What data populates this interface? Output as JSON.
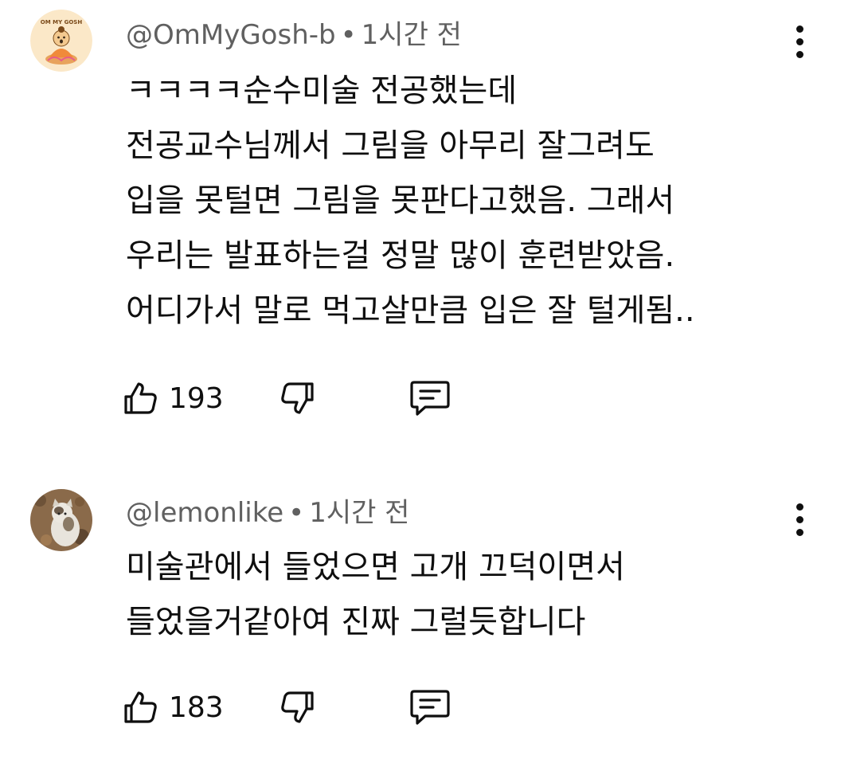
{
  "comments": [
    {
      "author": "@OmMyGosh-b",
      "separator": "•",
      "time": "1시간 전",
      "avatar_text": "OM MY GOSH",
      "text": "ㅋㅋㅋㅋ순수미술 전공했는데\n전공교수님께서 그림을 아무리 잘그려도\n입을 못털면 그림을 못판다고했음. 그래서\n우리는 발표하는걸 정말 많이 훈련받았음.\n어디가서 말로 먹고살만큼 입은 잘 털게됨..",
      "likes": "193"
    },
    {
      "author": "@lemonlike",
      "separator": "•",
      "time": "1시간 전",
      "text": "미술관에서 들었으면 고개 끄덕이면서\n들었을거같아여 진짜 그럴듯합니다",
      "likes": "183"
    }
  ],
  "icons": {
    "like": "thumbs-up-icon",
    "dislike": "thumbs-down-icon",
    "reply": "comment-icon",
    "more": "more-vertical-icon"
  },
  "colors": {
    "text": "#0f0f0f",
    "meta": "#606060",
    "background": "#ffffff"
  }
}
